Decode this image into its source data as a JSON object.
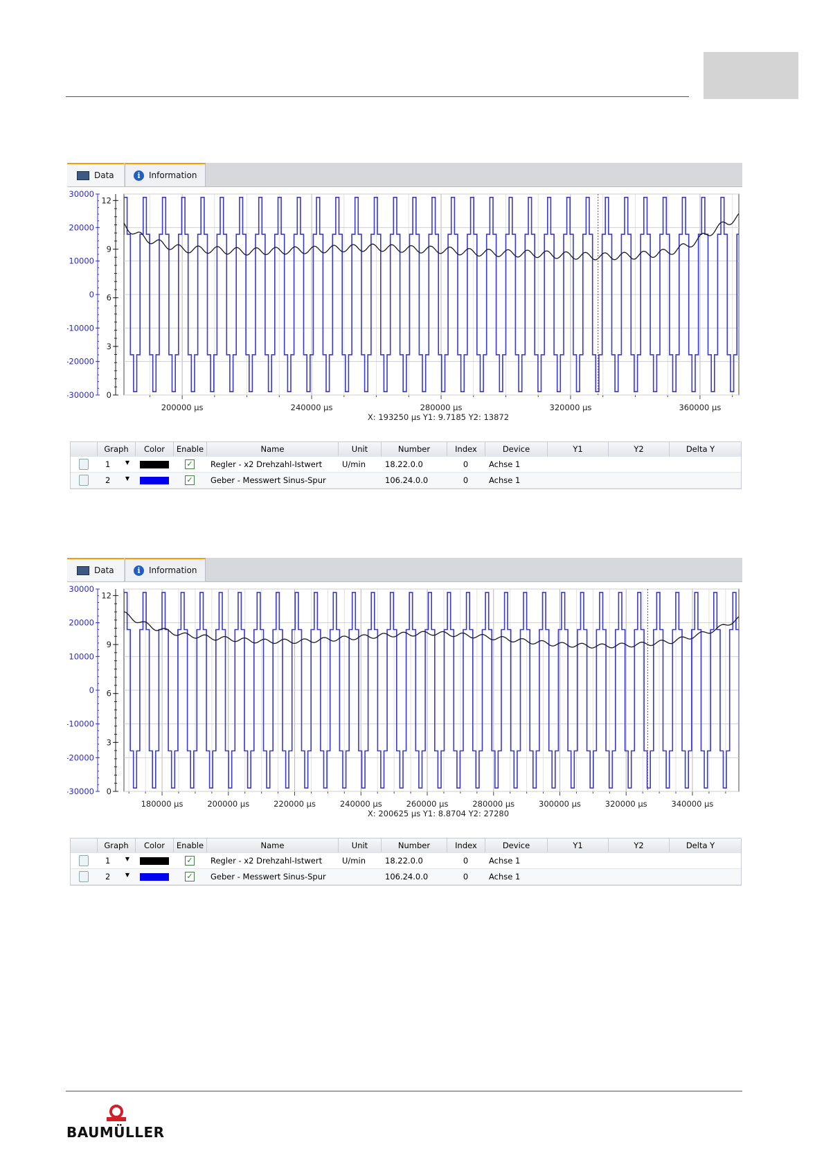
{
  "footer": {
    "brand": "BAUMÜLLER"
  },
  "panels": [
    {
      "tabs": {
        "data": "Data",
        "info": "Information"
      },
      "readout": "X: 193250 µs  Y1: 9.7185  Y2: 13872",
      "chart_data": {
        "type": "line",
        "x_ticks": [
          "200000 µs",
          "240000 µs",
          "280000 µs",
          "320000 µs",
          "360000 µs"
        ],
        "x_tick_values": [
          200000,
          240000,
          280000,
          320000,
          360000
        ],
        "xlim": [
          182000,
          372000
        ],
        "y2_ticks": [
          "30000",
          "20000",
          "10000",
          "0",
          "-10000",
          "-20000",
          "-30000"
        ],
        "y2_lim": [
          -30000,
          30000
        ],
        "y1_ticks": [
          "12",
          "9",
          "6",
          "3",
          "0"
        ],
        "y1_lim": [
          0,
          12.4
        ],
        "cursor_x": 328500,
        "grid": true,
        "series": [
          {
            "axis": "y1",
            "color": "#1a1a1a",
            "points": [
              [
                182000,
                10.5
              ],
              [
                186000,
                9.9
              ],
              [
                192000,
                9.4
              ],
              [
                200000,
                9.0
              ],
              [
                210000,
                8.95
              ],
              [
                220000,
                8.85
              ],
              [
                230000,
                8.9
              ],
              [
                240000,
                8.95
              ],
              [
                250000,
                9.05
              ],
              [
                260000,
                9.1
              ],
              [
                270000,
                9.0
              ],
              [
                280000,
                8.95
              ],
              [
                290000,
                8.8
              ],
              [
                300000,
                8.75
              ],
              [
                310000,
                8.7
              ],
              [
                320000,
                8.6
              ],
              [
                330000,
                8.55
              ],
              [
                340000,
                8.6
              ],
              [
                350000,
                8.8
              ],
              [
                356000,
                9.2
              ],
              [
                362000,
                9.9
              ],
              [
                368000,
                10.6
              ],
              [
                372000,
                11.0
              ]
            ]
          },
          {
            "axis": "y2",
            "color": "#3a3ac8",
            "type": "sine-trace",
            "period_us": 5950,
            "amplitude": 29000
          }
        ]
      },
      "legend": {
        "headers": [
          "Graph",
          "Color",
          "Enable",
          "Name",
          "Unit",
          "Number",
          "Index",
          "Device",
          "Y1",
          "Y2",
          "Delta Y"
        ],
        "rows": [
          {
            "graph": "1",
            "color": "#000000",
            "enabled": true,
            "name": "Regler - x2 Drehzahl-Istwert",
            "unit": "U/min",
            "number": "18.22.0.0",
            "index": "0",
            "device": "Achse 1"
          },
          {
            "graph": "2",
            "color": "#0000ee",
            "enabled": true,
            "name": "Geber - Messwert Sinus-Spur",
            "unit": "",
            "number": "106.24.0.0",
            "index": "0",
            "device": "Achse 1"
          }
        ]
      }
    },
    {
      "tabs": {
        "data": "Data",
        "info": "Information"
      },
      "readout": "X: 200625 µs  Y1: 8.8704  Y2: 27280",
      "chart_data": {
        "type": "line",
        "x_ticks": [
          "180000 µs",
          "200000 µs",
          "220000 µs",
          "240000 µs",
          "260000 µs",
          "280000 µs",
          "300000 µs",
          "320000 µs",
          "340000 µs"
        ],
        "x_tick_values": [
          180000,
          200000,
          220000,
          240000,
          260000,
          280000,
          300000,
          320000,
          340000
        ],
        "xlim": [
          168500,
          354000
        ],
        "y2_ticks": [
          "30000",
          "20000",
          "10000",
          "0",
          "-10000",
          "-20000",
          "-30000"
        ],
        "y2_lim": [
          -30000,
          30000
        ],
        "y1_ticks": [
          "12",
          "9",
          "6",
          "3",
          "0"
        ],
        "y1_lim": [
          0,
          12.4
        ],
        "cursor_x": 326500,
        "grid": true,
        "series": [
          {
            "axis": "y1",
            "color": "#1a1a1a",
            "points": [
              [
                168500,
                10.9
              ],
              [
                172000,
                10.5
              ],
              [
                178000,
                10.0
              ],
              [
                186000,
                9.6
              ],
              [
                196000,
                9.4
              ],
              [
                210000,
                9.2
              ],
              [
                222000,
                9.2
              ],
              [
                236000,
                9.4
              ],
              [
                250000,
                9.6
              ],
              [
                262000,
                9.7
              ],
              [
                276000,
                9.5
              ],
              [
                290000,
                9.2
              ],
              [
                300000,
                9.0
              ],
              [
                312000,
                8.9
              ],
              [
                324000,
                9.0
              ],
              [
                334000,
                9.2
              ],
              [
                342000,
                9.6
              ],
              [
                348000,
                10.0
              ],
              [
                354000,
                10.6
              ]
            ]
          },
          {
            "axis": "y2",
            "color": "#3a3ac8",
            "type": "sine-trace",
            "period_us": 5740,
            "amplitude": 29000
          }
        ]
      },
      "legend": {
        "headers": [
          "Graph",
          "Color",
          "Enable",
          "Name",
          "Unit",
          "Number",
          "Index",
          "Device",
          "Y1",
          "Y2",
          "Delta Y"
        ],
        "rows": [
          {
            "graph": "1",
            "color": "#000000",
            "enabled": true,
            "name": "Regler - x2 Drehzahl-Istwert",
            "unit": "U/min",
            "number": "18.22.0.0",
            "index": "0",
            "device": "Achse 1"
          },
          {
            "graph": "2",
            "color": "#0000ee",
            "enabled": true,
            "name": "Geber - Messwert Sinus-Spur",
            "unit": "",
            "number": "106.24.0.0",
            "index": "0",
            "device": "Achse 1"
          }
        ]
      }
    }
  ]
}
